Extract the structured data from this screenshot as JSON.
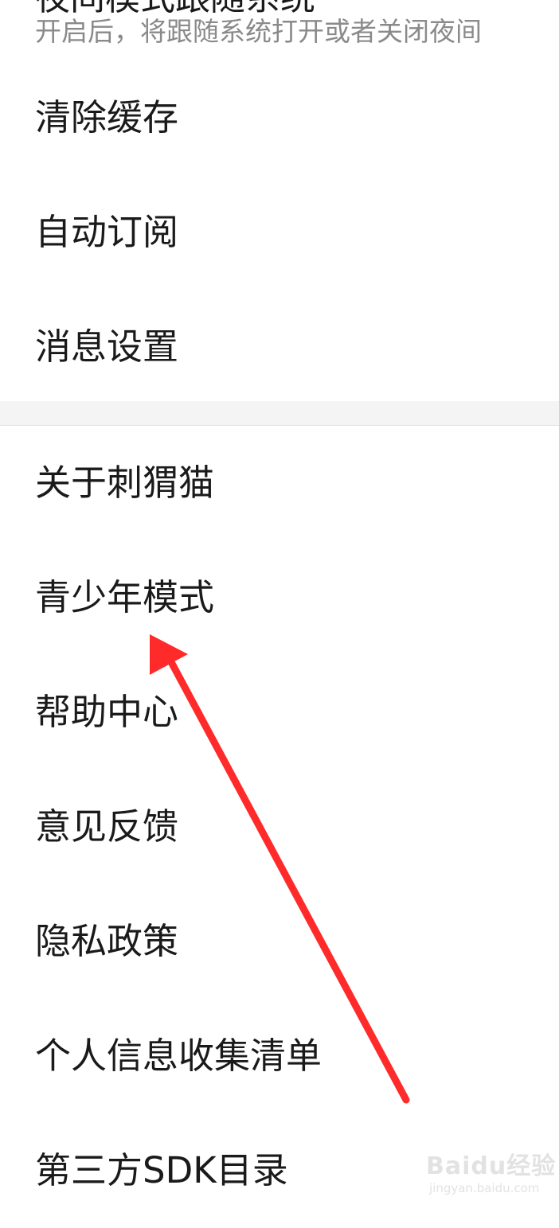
{
  "night_mode": {
    "title": "夜间模式跟随系统",
    "description": "开启后，将跟随系统打开或者关闭夜间"
  },
  "settings_group_1": [
    {
      "label": "清除缓存"
    },
    {
      "label": "自动订阅"
    },
    {
      "label": "消息设置"
    }
  ],
  "settings_group_2": [
    {
      "label": "关于刺猬猫"
    },
    {
      "label": "青少年模式"
    },
    {
      "label": "帮助中心"
    },
    {
      "label": "意见反馈"
    },
    {
      "label": "隐私政策"
    },
    {
      "label": "个人信息收集清单"
    },
    {
      "label": "第三方SDK目录"
    }
  ],
  "annotation": {
    "arrow_color": "#ff2a2a",
    "points_to": "青少年模式"
  },
  "watermark": {
    "main": "Baidu经验",
    "sub": "jingyan.baidu.com"
  }
}
